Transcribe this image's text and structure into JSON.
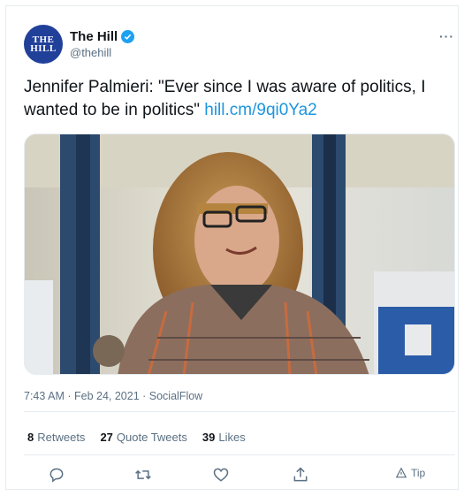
{
  "account": {
    "display_name": "The Hill",
    "handle": "@thehill",
    "avatar_line1": "THE",
    "avatar_line2": "HILL",
    "avatar_color": "#21409a",
    "verified": true
  },
  "tweet": {
    "text": "Jennifer Palmieri: \"Ever since I was aware of politics, I wanted to be in politics\"",
    "link": "hill.cm/9qi0Ya2",
    "link_color": "#1b95e0"
  },
  "meta": {
    "time": "7:43 AM",
    "separator1": " · ",
    "date": "Feb 24, 2021",
    "separator2": " · ",
    "source": "SocialFlow"
  },
  "stats": {
    "retweets_count": "8",
    "retweets_label": "Retweets",
    "quote_count": "27",
    "quote_label": "Quote Tweets",
    "likes_count": "39",
    "likes_label": "Likes"
  },
  "actions": {
    "reply_icon": "reply-icon",
    "retweet_icon": "retweet-icon",
    "like_icon": "heart-icon",
    "share_icon": "share-icon",
    "tip_label": "Tip"
  },
  "more_glyph": "···"
}
